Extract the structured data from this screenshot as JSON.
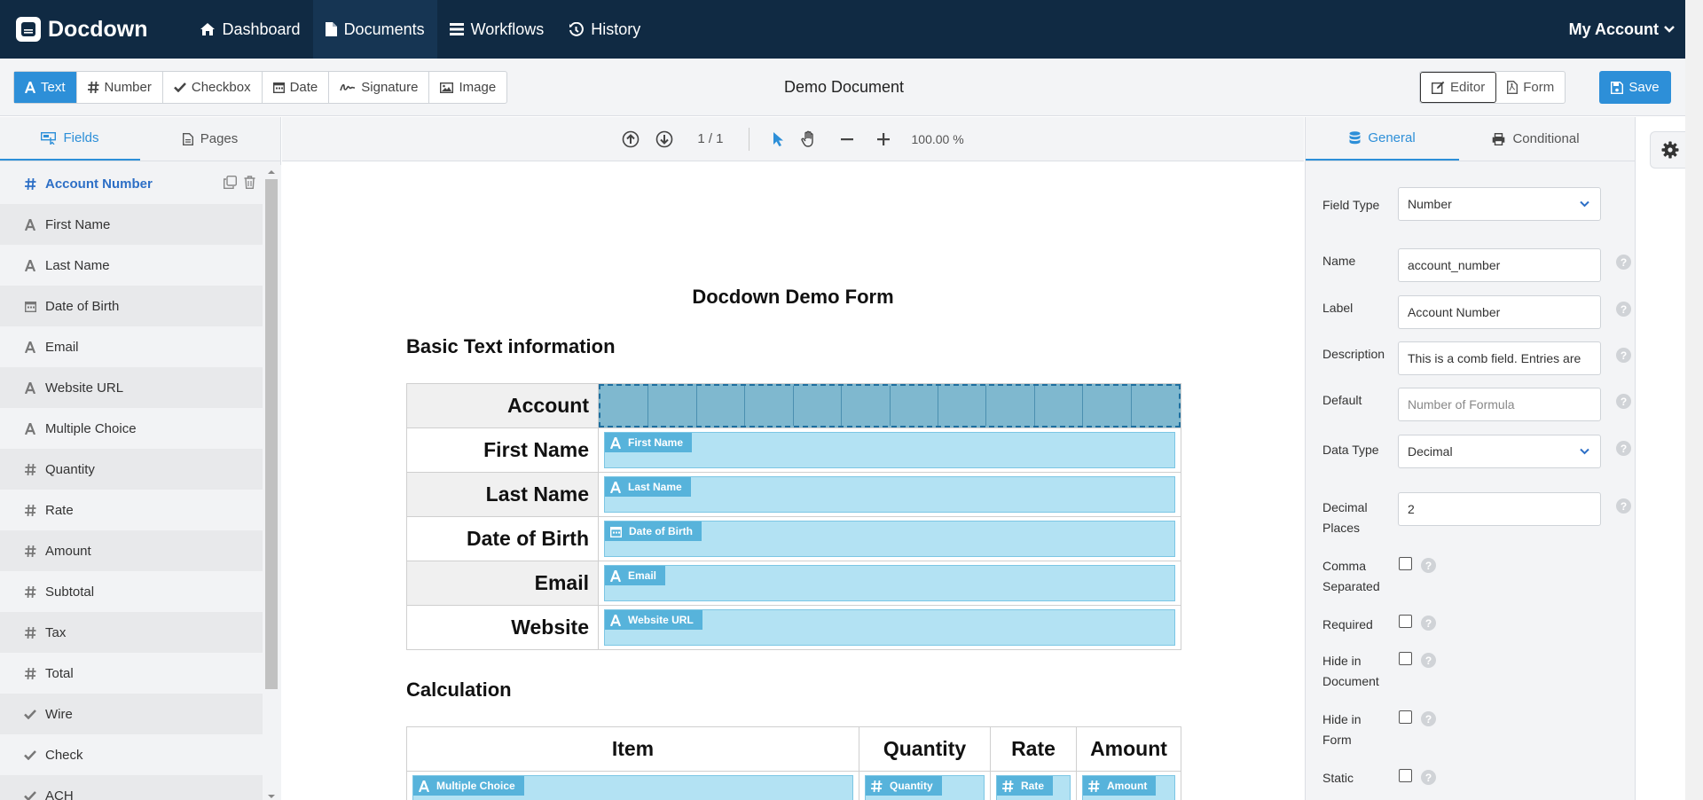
{
  "app": {
    "brand": "Docdown",
    "nav": [
      {
        "label": "Dashboard",
        "icon": "home-icon"
      },
      {
        "label": "Documents",
        "icon": "file-icon"
      },
      {
        "label": "Workflows",
        "icon": "list-icon"
      },
      {
        "label": "History",
        "icon": "history-icon"
      }
    ],
    "active_nav": "Documents",
    "account_label": "My Account"
  },
  "toolbar": {
    "field_types": [
      "Text",
      "Number",
      "Checkbox",
      "Date",
      "Signature",
      "Image"
    ],
    "active_field_type": "Text",
    "document_title": "Demo Document",
    "view_editor": "Editor",
    "view_form": "Form",
    "save_label": "Save"
  },
  "left_panel": {
    "tabs": [
      "Fields",
      "Pages"
    ],
    "active_tab": "Fields",
    "fields": [
      {
        "label": "Account Number",
        "type": "number",
        "selected": true
      },
      {
        "label": "First Name",
        "type": "text"
      },
      {
        "label": "Last Name",
        "type": "text"
      },
      {
        "label": "Date of Birth",
        "type": "date"
      },
      {
        "label": "Email",
        "type": "text"
      },
      {
        "label": "Website URL",
        "type": "text"
      },
      {
        "label": "Multiple Choice",
        "type": "text"
      },
      {
        "label": "Quantity",
        "type": "number"
      },
      {
        "label": "Rate",
        "type": "number"
      },
      {
        "label": "Amount",
        "type": "number"
      },
      {
        "label": "Subtotal",
        "type": "number"
      },
      {
        "label": "Tax",
        "type": "number"
      },
      {
        "label": "Total",
        "type": "number"
      },
      {
        "label": "Wire",
        "type": "checkbox"
      },
      {
        "label": "Check",
        "type": "checkbox"
      },
      {
        "label": "ACH",
        "type": "checkbox"
      }
    ]
  },
  "canvas": {
    "page_indicator": "1 / 1",
    "zoom": "100.00 %",
    "heading": "Docdown Demo Form",
    "section1": "Basic Text information",
    "section2": "Calculation",
    "rows": [
      {
        "label": "Account",
        "field": "",
        "field_type": "comb"
      },
      {
        "label": "First Name",
        "field": "First Name",
        "field_type": "text"
      },
      {
        "label": "Last Name",
        "field": "Last Name",
        "field_type": "text"
      },
      {
        "label": "Date of Birth",
        "field": "Date of Birth",
        "field_type": "date"
      },
      {
        "label": "Email",
        "field": "Email",
        "field_type": "text"
      },
      {
        "label": "Website",
        "field": "Website URL",
        "field_type": "text"
      }
    ],
    "calc_headers": [
      "Item",
      "Quantity",
      "Rate",
      "Amount"
    ],
    "calc_fields": [
      {
        "label": "Multiple Choice",
        "type": "text"
      },
      {
        "label": "Quantity",
        "type": "number"
      },
      {
        "label": "Rate",
        "type": "number"
      },
      {
        "label": "Amount",
        "type": "number"
      }
    ]
  },
  "right_panel": {
    "tabs": [
      "General",
      "Conditional"
    ],
    "active_tab": "General",
    "field_type_label": "Field Type",
    "field_type_value": "Number",
    "name_label": "Name",
    "name_value": "account_number",
    "label_label": "Label",
    "label_value": "Account Number",
    "description_label": "Description",
    "description_value": "This is a comb field. Entries are",
    "default_label": "Default",
    "default_placeholder": "Number of Formula",
    "data_type_label": "Data Type",
    "data_type_value": "Decimal",
    "decimal_places_label": "Decimal Places",
    "decimal_places_value": "2",
    "comma_label": "Comma Separated",
    "required_label": "Required",
    "hide_doc_label": "Hide in Document",
    "hide_form_label": "Hide in Form",
    "static_label": "Static"
  },
  "colors": {
    "navbar": "#102a43",
    "accent": "#2d8fd8",
    "field_fill": "#b3e2f3",
    "field_tag": "#57b3db"
  }
}
